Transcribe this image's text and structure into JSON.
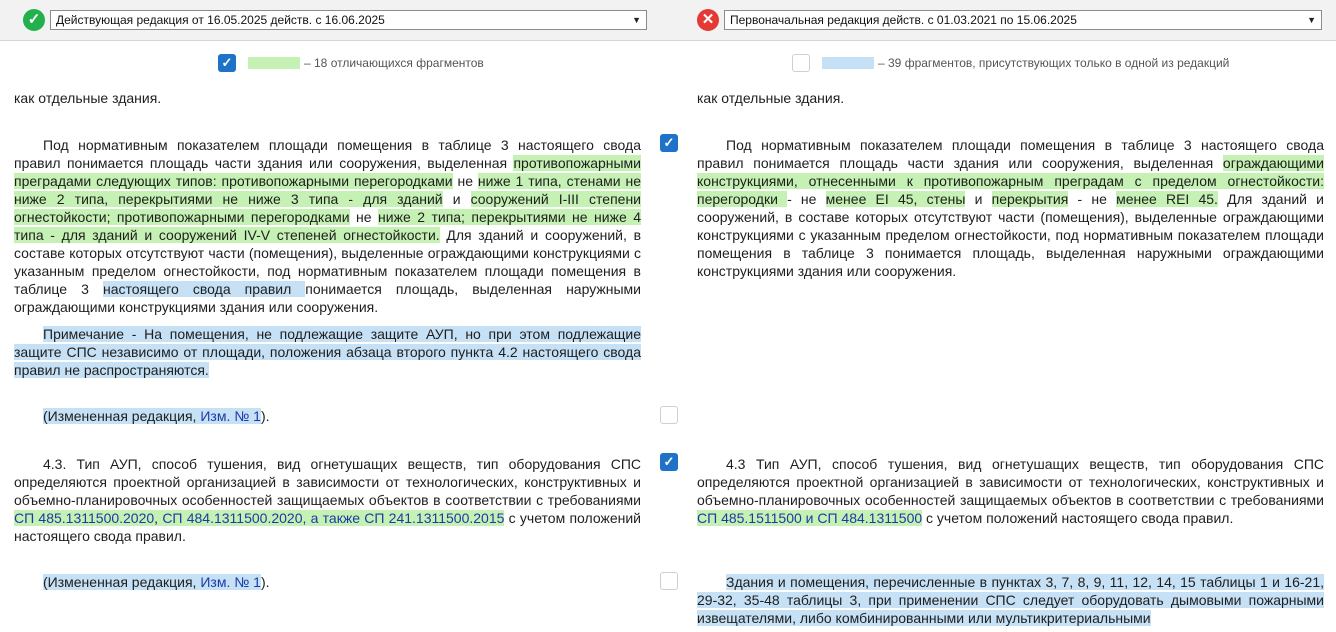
{
  "left_version": {
    "label": "Действующая редакция от 16.05.2025 действ. с 16.06.2025",
    "status": "valid"
  },
  "right_version": {
    "label": "Первоначальная редакция действ. с 01.03.2021 по 15.06.2025",
    "status": "invalid"
  },
  "legend": {
    "changed": {
      "text": "– 18 отличающихся фрагментов",
      "checked": true,
      "color": "#c6f1b4"
    },
    "unique": {
      "text": "– 39 фрагментов, присутствующих только в одной из редакций",
      "checked": false,
      "color": "#c6e1f5"
    }
  },
  "left": {
    "p0": "как отдельные здания.",
    "p1": {
      "a": "Под нормативным показателем площади помещения в таблице 3 настоящего свода правил понимается площадь части здания или сооружения, выделенная ",
      "b": "противопожарными преградами следующих типов: противопожарными перегородками",
      "c": " не ",
      "d": "ниже 1 типа, стенами не ниже 2 типа, перекрытиями не ниже 3 типа - для зданий",
      "e": " и ",
      "f": "сооружений I-III степени огнестойкости; противопожарными перегородками",
      "g": " не ",
      "h": "ниже 2 типа; перекрытиями не ниже 4 типа - для зданий и сооружений IV-V степеней огнестойкости.",
      "i": " Для зданий и сооружений, в составе которых отсутствуют части (помещения), выделенные ограждающими конструкциями с указанным пределом огнестойкости, под нормативным показателем площади помещения в таблице 3 ",
      "j": "настоящего свода правил ",
      "k": " понимается площадь, выделенная наружными ограждающими конструкциями здания или сооружения."
    },
    "note": "Примечание - На помещения, не подлежащие защите АУП, но при этом подлежащие защите СПС независимо от площади, положения абзаца второго пункта 4.2 настоящего свода правил не распространяются.",
    "rev1": {
      "a": "(Измененная редакция, ",
      "link": "Изм. № 1",
      "b": ")."
    },
    "p43": {
      "a": "4.3. Тип АУП, способ тушения, вид огнетушащих веществ, тип оборудования СПС определяются проектной организацией в зависимости от технологических, конструктивных и объемно-планировочных особенностей защищаемых объектов в соответствии с требованиями ",
      "l1": "СП 485.1311500.2020",
      "sep1": ", ",
      "l2": "СП 484.1311500.2020",
      "mid": ", а также ",
      "l3": "СП 241.1311500.2015",
      "z": " с учетом положений настоящего свода правил."
    },
    "rev2": {
      "a": "(Измененная редакция, ",
      "link": "Изм. № 1",
      "b": ")."
    }
  },
  "right": {
    "p0": "как отдельные здания.",
    "p1": {
      "a": "Под нормативным показателем площади помещения в таблице 3 настоящего свода правил понимается площадь части здания или сооружения, выделенная ",
      "b": "ограждающими конструкциями, отнесенными к противопожарным преградам с пределом огнестойкости: перегородки ",
      "c": " - не ",
      "d": "менее EI 45, стены",
      "e": " и ",
      "f": "перекрытия",
      "g": " - не ",
      "h": "менее REI 45.",
      "i": " Для зданий и сооружений, в составе которых отсутствуют части (помещения), выделенные ограждающими конструкциями с указанным пределом огнестойкости, под нормативным показателем площади помещения в таблице 3 понимается площадь, выделенная наружными ограждающими конструкциями здания или сооружения."
    },
    "p43": {
      "a": "4.3 Тип АУП, способ тушения, вид огнетушащих веществ, тип оборудования СПС определяются проектной организацией в зависимости от технологических, конструктивных и объемно-планировочных особенностей защищаемых объектов в соответствии с требованиями ",
      "l1": "СП 485.1511500 и СП 484.1311500",
      "z": " с учетом положений настоящего свода правил."
    },
    "extra": "Здания и помещения, перечисленные в пунктах 3, 7, 8, 9, 11, 12, 14, 15 таблицы 1 и 16-21, 29-32, 35-48 таблицы 3, при применении СПС следует оборудовать дымовыми пожарными извещателями, либо комбинированными или мультикритериальными"
  },
  "row_checks": [
    true,
    false,
    true,
    false
  ],
  "icons": {
    "ok": "check-circle-icon",
    "bad": "close-circle-icon",
    "dropdown": "chevron-down-icon"
  }
}
